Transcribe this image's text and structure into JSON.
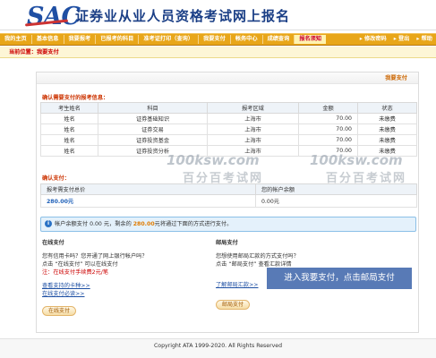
{
  "header": {
    "logo_text": "SAC",
    "title": "证券业从业人员资格考试网上报名"
  },
  "nav": {
    "items": [
      "我的主页",
      "基本信息",
      "我要报考",
      "已报考的科目",
      "准考证打印（查询）",
      "我要支付",
      "帐务中心",
      "成绩查询",
      "报名须知"
    ],
    "active_index": 8,
    "right_items": [
      "修改密码",
      "登出",
      "帮助"
    ]
  },
  "location": {
    "label": "当前位置：",
    "current": "我要支付"
  },
  "panel": {
    "head_label": "我要支付",
    "confirm_title": "确认需要支付的报考信息：",
    "exam_table": {
      "headers": [
        "考生姓名",
        "科目",
        "报考区域",
        "金额",
        "状态"
      ],
      "rows": [
        [
          "姓名",
          "证券基础知识",
          "上海市",
          "70.00",
          "未缴费"
        ],
        [
          "姓名",
          "证券交易",
          "上海市",
          "70.00",
          "未缴费"
        ],
        [
          "姓名",
          "证券投资基金",
          "上海市",
          "70.00",
          "未缴费"
        ],
        [
          "姓名",
          "证券投资分析",
          "上海市",
          "70.00",
          "未缴费"
        ]
      ]
    },
    "pay_title": "确认支付：",
    "pay_table": {
      "headers": [
        "报考需支付总价",
        "您的帐户余额"
      ],
      "values": [
        "280.00元",
        "0.00元"
      ]
    },
    "notice": {
      "prefix": "帐户余额支付",
      "balance": "0.00",
      "mid": "元，剩余的",
      "remaining": "280.00",
      "suffix": "元将通过下面的方式进行支付。"
    },
    "online": {
      "title": "在线支付",
      "line1": "您有信用卡吗？您开通了网上银行帐户吗？",
      "line2": "点击 “在线支付” 可以在线支付",
      "fee_note": "注：在线支付手续费2元/笔",
      "link1": "查看支持的卡种>>",
      "link2": "在线支付必读>>",
      "button": "在线支付"
    },
    "postal": {
      "title": "邮局支付",
      "line1": "您想使用邮局汇款的方式支付吗？",
      "line2": "点击 “邮局支付” 查看汇款详情",
      "link1": "了解邮局汇款>>",
      "button": "邮局支付"
    },
    "callout": "进入我要支付，点击邮局支付"
  },
  "watermark": {
    "logo": "100ksw.com",
    "text": "百分百考试网"
  },
  "footer": {
    "copyright": "Copyright ATA 1999-2020. All Rights Reserved"
  },
  "colors": {
    "nav_bg": "#e8a619",
    "brand_blue": "#1f4fa3",
    "accent_red": "#c30",
    "notice_bg": "#e4f1fb"
  }
}
